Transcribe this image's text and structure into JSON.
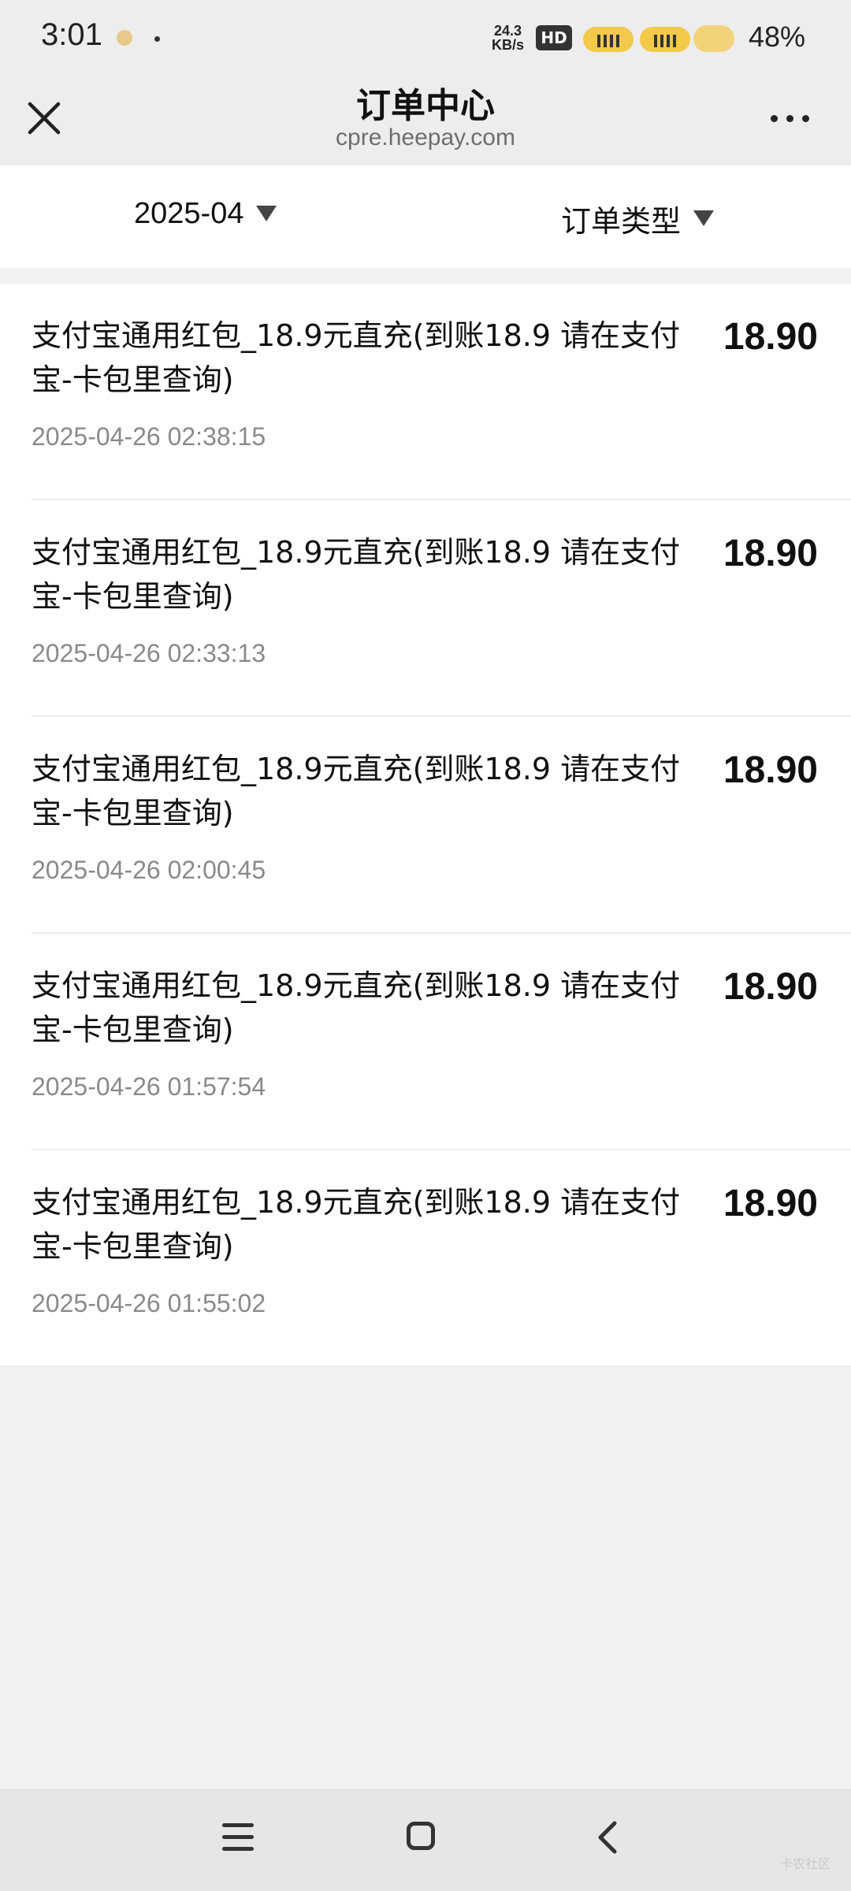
{
  "status_bar": {
    "time": "3:01",
    "net_speed_value": "24.3",
    "net_speed_unit": "KB/s",
    "hd_badge": "HD",
    "battery": "48%"
  },
  "header": {
    "title": "订单中心",
    "subtitle": "cpre.heepay.com"
  },
  "filters": {
    "date": "2025-04",
    "type": "订单类型"
  },
  "orders": [
    {
      "name": "支付宝通用红包_18.9元直充(到账18.9 请在支付宝-卡包里查询)",
      "time": "2025-04-26 02:38:15",
      "amount": "18.90"
    },
    {
      "name": "支付宝通用红包_18.9元直充(到账18.9 请在支付宝-卡包里查询)",
      "time": "2025-04-26 02:33:13",
      "amount": "18.90"
    },
    {
      "name": "支付宝通用红包_18.9元直充(到账18.9 请在支付宝-卡包里查询)",
      "time": "2025-04-26 02:00:45",
      "amount": "18.90"
    },
    {
      "name": "支付宝通用红包_18.9元直充(到账18.9 请在支付宝-卡包里查询)",
      "time": "2025-04-26 01:57:54",
      "amount": "18.90"
    },
    {
      "name": "支付宝通用红包_18.9元直充(到账18.9 请在支付宝-卡包里查询)",
      "time": "2025-04-26 01:55:02",
      "amount": "18.90"
    }
  ],
  "watermark": "卡农社区",
  "icons": {
    "close": "close-icon",
    "more": "more-icon",
    "dropdown": "triangle-down-icon",
    "nav_menu": "menu-icon",
    "nav_home": "home-icon",
    "nav_back": "back-icon"
  }
}
